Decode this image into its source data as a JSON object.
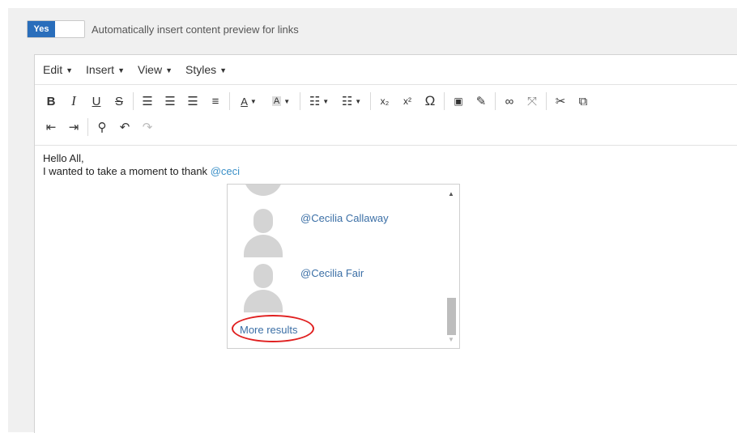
{
  "preview_toggle": {
    "state_label": "Yes",
    "label": "Automatically insert content preview for links"
  },
  "menubar": [
    {
      "label": "Edit"
    },
    {
      "label": "Insert"
    },
    {
      "label": "View"
    },
    {
      "label": "Styles"
    }
  ],
  "toolbar": {
    "bold": "B",
    "italic": "I",
    "underline": "U",
    "strike": "S",
    "subscript": "x₂",
    "superscript": "x²",
    "omega": "Ω"
  },
  "content": {
    "line1": "Hello All,",
    "line2": "I wanted to take a moment to thank ",
    "mention": "@ceci"
  },
  "mention_dropdown": {
    "items": [
      {
        "name": "@Cecilia Callaway"
      },
      {
        "name": "@Cecilia Fair"
      }
    ],
    "more_label": "More results"
  },
  "colors": {
    "accent": "#2a6ebb",
    "link": "#3b6fa6",
    "mention": "#3a8fc7",
    "annotation": "#e02020"
  }
}
